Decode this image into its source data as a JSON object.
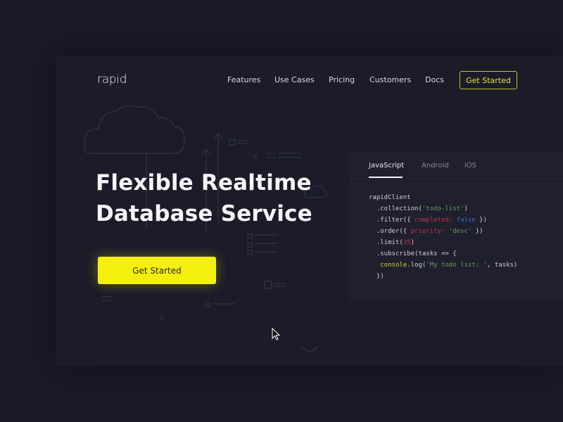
{
  "header": {
    "logo": "rapid",
    "nav": [
      "Features",
      "Use Cases",
      "Pricing",
      "Customers",
      "Docs"
    ],
    "cta_label": "Get Started"
  },
  "hero": {
    "title_line1": "Flexible Realtime",
    "title_line2": "Database Service",
    "cta_label": "Get Started"
  },
  "code_panel": {
    "tabs": [
      "JavaScript",
      "Android",
      "iOS"
    ],
    "active_tab": "JavaScript",
    "code": {
      "l1": "rapidClient",
      "l2a": "  .collection(",
      "l2b": "'todo-list'",
      "l2c": ")",
      "l3a": "  .filter({ ",
      "l3b": "completed:",
      "l3c": " false",
      "l3d": " })",
      "l4a": "  .order({ ",
      "l4b": "priority:",
      "l4c": " 'desc'",
      "l4d": " })",
      "l5a": "  .limit(",
      "l5b": "35",
      "l5c": ")",
      "l6": "  .subscribe(tasks => {",
      "l7a": "   ",
      "l7b": "console",
      "l7c": ".log(",
      "l7d": "'My todo list: '",
      "l7e": ", tasks)",
      "l8": "  })"
    }
  },
  "colors": {
    "accent": "#f4f00e",
    "background": "#1a1a28",
    "string": "#5fa04e",
    "keyword": "#c0364a",
    "boolean": "#3a6fc4"
  },
  "icons": [
    "cloud-icon",
    "arrow-up-icon",
    "checkbox-icon",
    "close-icon",
    "chevron-down-icon",
    "mouse-cursor-icon"
  ]
}
